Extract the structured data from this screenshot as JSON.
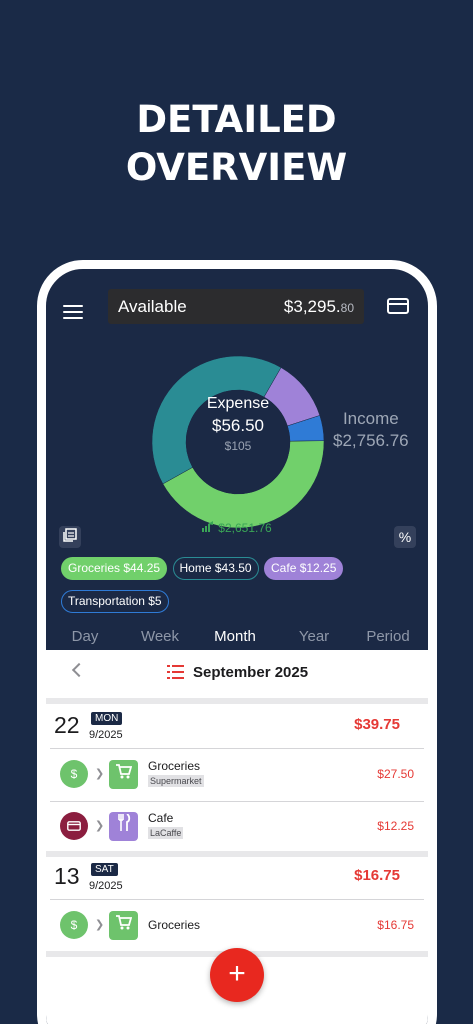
{
  "headline": {
    "line1": "DETAILED",
    "line2": "OVERVIEW"
  },
  "topbar": {
    "available_label": "Available",
    "available_amount": "$3,295.",
    "available_cents": "80"
  },
  "chart_data": {
    "type": "pie",
    "categories": [
      "Groceries",
      "Home",
      "Cafe",
      "Transportation"
    ],
    "values": [
      44.25,
      43.5,
      12.25,
      5
    ],
    "colors": [
      "#71d06b",
      "#2a8c94",
      "#9f82d8",
      "#2f7bd6"
    ],
    "title": "Expense",
    "donut": true
  },
  "summary": {
    "center_title": "Expense",
    "center_value": "$56.50",
    "center_sub": "$105",
    "income_label": "Income",
    "income_value": "$2,756.76",
    "balance": "$2,651.76"
  },
  "chips": [
    {
      "label": "Groceries $44.25",
      "bg": "#71d06b",
      "border": "#71d06b"
    },
    {
      "label": "Home $43.50",
      "bg": "#1b2945",
      "border": "#2a8c94"
    },
    {
      "label": "Cafe $12.25",
      "bg": "#9f82d8",
      "border": "#9f82d8"
    },
    {
      "label": "Transportation $5",
      "bg": "#1b2945",
      "border": "#2f7bd6"
    }
  ],
  "tabs": [
    "Day",
    "Week",
    "Month",
    "Year",
    "Period"
  ],
  "active_tab": "Month",
  "month_label": "September 2025",
  "days": [
    {
      "num": "22",
      "dow": "MON",
      "date": "9/2025",
      "total": "$39.75",
      "items": [
        {
          "account_icon": "money-bag-icon",
          "account_color": "#6ec36c",
          "category_color": "#6ec36c",
          "category_icon": "cart-icon",
          "name": "Groceries",
          "tag": "Supermarket",
          "amount": "$27.50"
        },
        {
          "account_icon": "credit-card-icon",
          "account_color": "#8b1e3f",
          "category_color": "#9f82d8",
          "category_icon": "fork-knife-icon",
          "name": "Cafe",
          "tag": "LaCaffe",
          "amount": "$12.25"
        }
      ]
    },
    {
      "num": "13",
      "dow": "SAT",
      "date": "9/2025",
      "total": "$16.75",
      "items": [
        {
          "account_icon": "money-bag-icon",
          "account_color": "#6ec36c",
          "category_color": "#6ec36c",
          "category_icon": "cart-icon",
          "name": "Groceries",
          "tag": "",
          "amount": "$16.75"
        }
      ]
    }
  ],
  "fab_label": "+"
}
